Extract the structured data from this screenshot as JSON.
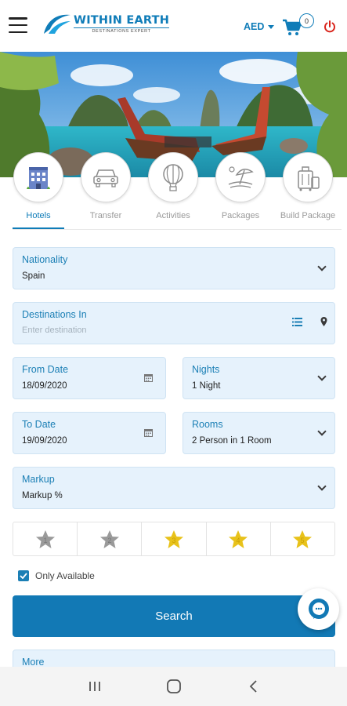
{
  "header": {
    "logo_title": "WITHIN EARTH",
    "logo_tagline": "DESTINATIONS EXPERT",
    "currency": "AED",
    "cart_count": "0",
    "icons": [
      "menu-icon",
      "cart-icon",
      "power-icon"
    ],
    "accent_color": "#0f7cb8"
  },
  "categories": [
    {
      "label": "Hotels",
      "icon": "hotel-icon",
      "active": true
    },
    {
      "label": "Transfer",
      "icon": "car-icon",
      "active": false
    },
    {
      "label": "Activities",
      "icon": "hot-air-balloon-icon",
      "active": false
    },
    {
      "label": "Packages",
      "icon": "beach-umbrella-icon",
      "active": false
    },
    {
      "label": "Build Package",
      "icon": "luggage-icon",
      "active": false
    }
  ],
  "form": {
    "nationality": {
      "label": "Nationality",
      "value": "Spain"
    },
    "destination": {
      "label": "Destinations In",
      "placeholder": "Enter destination"
    },
    "from_date": {
      "label": "From Date",
      "value": "18/09/2020"
    },
    "nights": {
      "label": "Nights",
      "value": "1 Night"
    },
    "to_date": {
      "label": "To Date",
      "value": "19/09/2020"
    },
    "rooms": {
      "label": "Rooms",
      "value": "2 Person in 1 Room"
    },
    "markup": {
      "label": "Markup",
      "value": "Markup %"
    },
    "stars": [
      {
        "value": "1",
        "selected": false
      },
      {
        "value": "2",
        "selected": false
      },
      {
        "value": "3",
        "selected": true
      },
      {
        "value": "4",
        "selected": true
      },
      {
        "value": "5",
        "selected": true
      }
    ],
    "only_available": {
      "label": "Only Available",
      "checked": true
    },
    "search_label": "Search",
    "more_label": "More"
  }
}
